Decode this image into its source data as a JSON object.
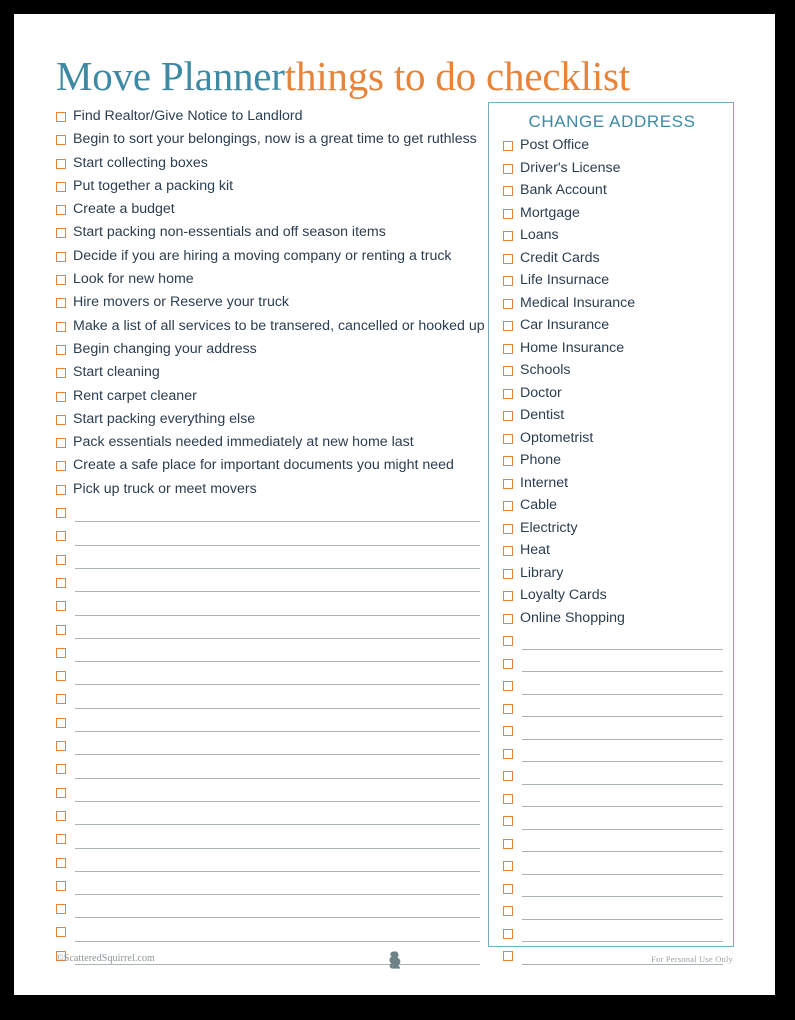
{
  "page": {
    "title_main": "Move Planner",
    "title_sub": "things to do checklist"
  },
  "colors": {
    "accent_teal": "#3E89A3",
    "accent_orange": "#E8833A",
    "text": "#2B3E50",
    "rule": "#A9B3B8",
    "panel_border": "#76AEC1",
    "frame": "#000000",
    "footer_text": "#8C9499"
  },
  "left_column": {
    "items": [
      "Find Realtor/Give Notice to Landlord",
      "Begin to sort your belongings, now is a great time to get ruthless",
      "Start collecting boxes",
      "Put together a packing kit",
      "Create a budget",
      "Start packing non-essentials and off season items",
      "Decide if you are hiring a moving company or renting a truck",
      "Look for new home",
      "Hire movers or Reserve your truck",
      "Make a list of all services to be transered, cancelled or hooked up",
      "Begin changing your address",
      "Start cleaning",
      "Rent carpet cleaner",
      "Start packing everything else",
      "Pack essentials needed immediately at new home last",
      "Create a safe place for important documents you might need",
      "Pick up truck or meet movers"
    ],
    "blank_rows": 20
  },
  "right_column": {
    "header": "CHANGE ADDRESS",
    "items": [
      "Post Office",
      "Driver's License",
      "Bank Account",
      "Mortgage",
      "Loans",
      "Credit Cards",
      "Life Insurnace",
      "Medical Insurance",
      "Car Insurance",
      "Home Insurance",
      "Schools",
      "Doctor",
      "Dentist",
      "Optometrist",
      "Phone",
      "Internet",
      "Cable",
      "Electricty",
      "Heat",
      "Library",
      "Loyalty Cards",
      "Online Shopping"
    ],
    "blank_rows": 15
  },
  "footer": {
    "credit": "©ScatteredSquirrel.com",
    "personal_use": "For Personal Use Only",
    "logo": "squirrel-logo"
  }
}
